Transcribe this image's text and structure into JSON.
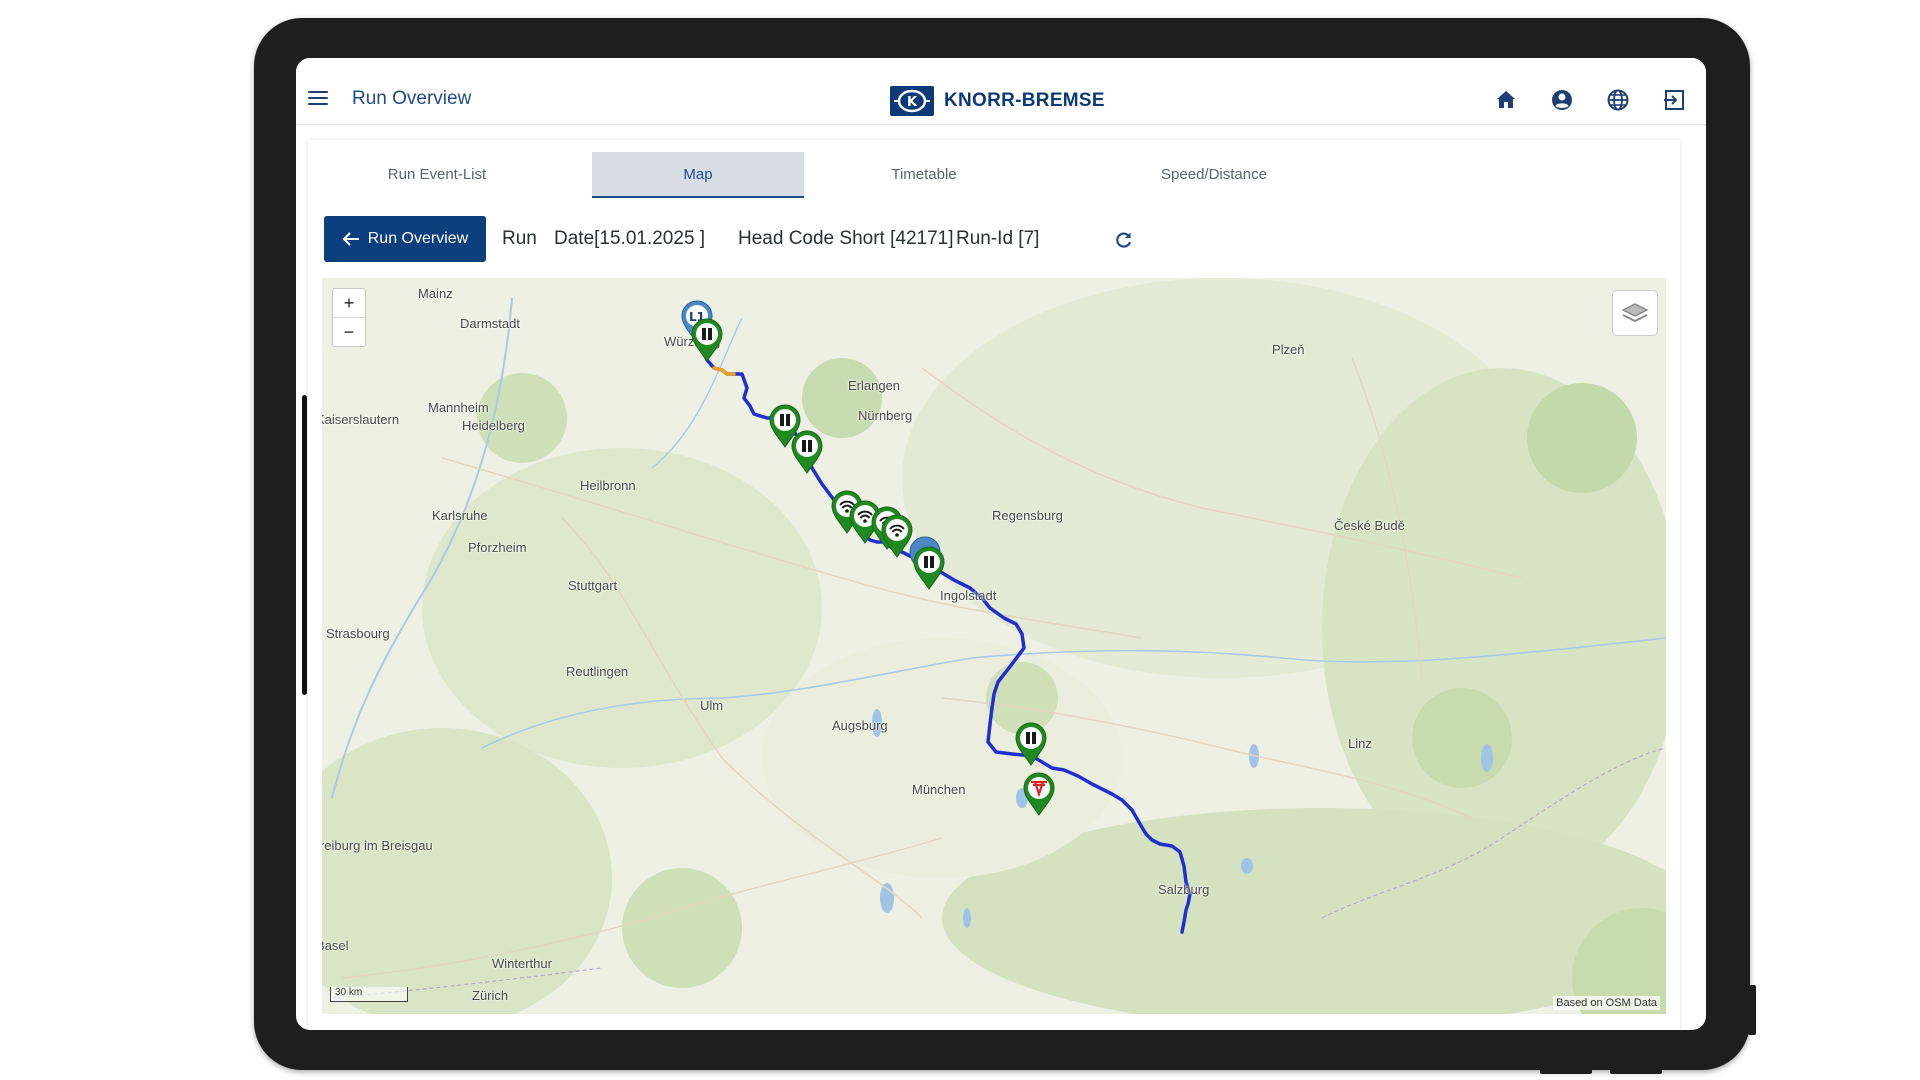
{
  "header": {
    "title": "Run Overview",
    "logo_text": "KNORR-BREMSE"
  },
  "tabs": [
    {
      "label": "Run Event-List"
    },
    {
      "label": "Map"
    },
    {
      "label": "Timetable"
    },
    {
      "label": "Speed/Distance"
    }
  ],
  "runbar": {
    "back_label": "Run Overview",
    "run_label": "Run",
    "date": "Date[15.01.2025 ]",
    "head_code": "Head Code Short [42171]",
    "run_id": "Run-Id [7]"
  },
  "map": {
    "zoom_in": "+",
    "zoom_out": "−",
    "scale_label": "30 km",
    "attribution": "Based on OSM Data",
    "marker_label": "L1",
    "cities": [
      "Mainz",
      "Darmstadt",
      "Würzburg",
      "Erlangen",
      "Nürnberg",
      "Plzeň",
      "Kaiserslautern",
      "Mannheim",
      "Heidelberg",
      "Heilbronn",
      "Karlsruhe",
      "Pforzheim",
      "Regensburg",
      "České Budě",
      "Stuttgart",
      "Ingolstadt",
      "Strasbourg",
      "Reutlingen",
      "Ulm",
      "Augsburg",
      "Linz",
      "München",
      "Freiburg im Breisgau",
      "Salzburg",
      "Basel",
      "Winterthur",
      "Zürich"
    ]
  },
  "colors": {
    "brand": "#0c3f7d",
    "route": "#1f2fd0",
    "route_highlight": "#f0a020",
    "marker_green": "#1f8a1f",
    "marker_blue": "#4a88c8"
  }
}
